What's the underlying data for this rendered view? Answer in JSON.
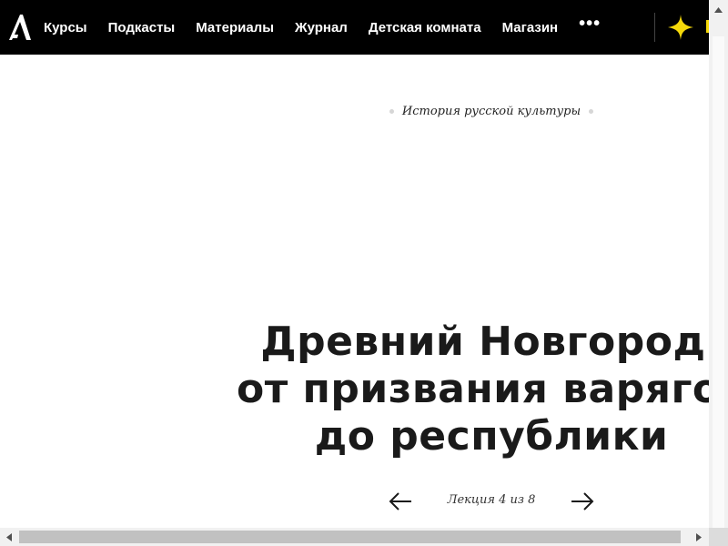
{
  "nav": {
    "items": [
      "Курсы",
      "Подкасты",
      "Материалы",
      "Журнал",
      "Детская комната",
      "Магазин"
    ],
    "more_label": "•••"
  },
  "icons": {
    "logo": "arzamas-logo-icon",
    "more": "more-dots-icon",
    "spark": "sparkle-icon",
    "prev": "arrow-left-icon",
    "next": "arrow-right-icon"
  },
  "colors": {
    "nav_bg": "#000000",
    "nav_text": "#ffffff",
    "accent": "#f5d90a",
    "page_text": "#1a1a1a"
  },
  "content": {
    "breadcrumb": "История русской культуры",
    "title_lines": [
      "Древний Новгород:",
      "от призвания варягов",
      "до республики"
    ],
    "pager_label": "Лекция 4 из 8"
  }
}
